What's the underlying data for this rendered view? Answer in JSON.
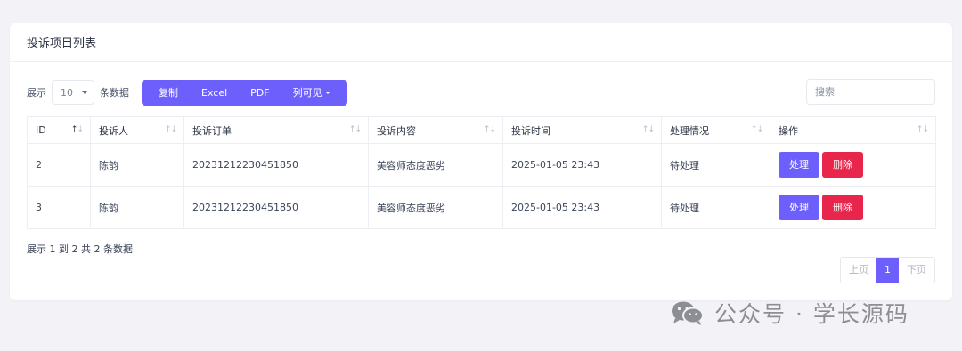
{
  "panel": {
    "title": "投诉项目列表"
  },
  "toolbar": {
    "show_label": "展示",
    "page_size": "10",
    "rows_label": "条数据",
    "buttons": [
      "复制",
      "Excel",
      "PDF",
      "列可见"
    ],
    "search_placeholder": "搜索"
  },
  "table": {
    "headers": [
      "ID",
      "投诉人",
      "投诉订单",
      "投诉内容",
      "投诉时间",
      "处理情况",
      "操作"
    ],
    "rows": [
      {
        "id": "2",
        "complainant": "陈韵",
        "order": "20231212230451850",
        "content": "美容师态度恶劣",
        "time": "2025-01-05 23:43",
        "status": "待处理"
      },
      {
        "id": "3",
        "complainant": "陈韵",
        "order": "20231212230451850",
        "content": "美容师态度恶劣",
        "time": "2025-01-05 23:43",
        "status": "待处理"
      }
    ],
    "action_handle": "处理",
    "action_delete": "删除"
  },
  "footer": {
    "info": "展示 1 到 2 共 2 条数据"
  },
  "pagination": {
    "prev": "上页",
    "current": "1",
    "next": "下页"
  },
  "watermark": {
    "text": "公众号 · 学长源码"
  },
  "colors": {
    "primary": "#6c5ffc",
    "danger": "#e8254b",
    "background": "#f2f2f7"
  }
}
